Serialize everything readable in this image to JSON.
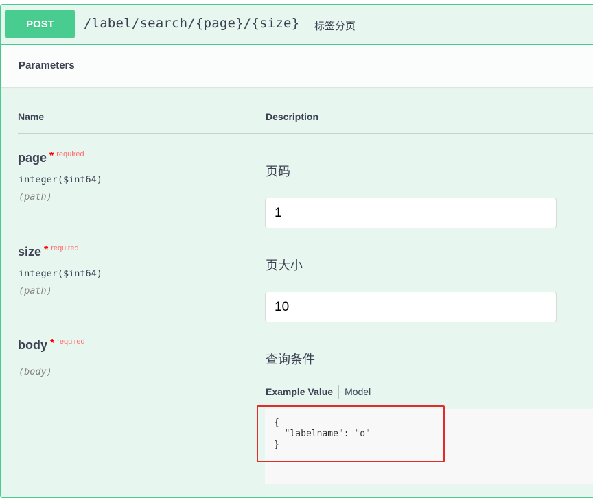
{
  "operation": {
    "method": "POST",
    "path": "/label/search/{page}/{size}",
    "summary": "标签分页",
    "method_color": "#49cc90"
  },
  "section": {
    "title": "Parameters"
  },
  "columns": {
    "name": "Name",
    "description": "Description"
  },
  "params": [
    {
      "name": "page",
      "required_star": "*",
      "required_label": "required",
      "type": "integer($int64)",
      "in": "(path)",
      "description": "页码",
      "value": "1"
    },
    {
      "name": "size",
      "required_star": "*",
      "required_label": "required",
      "type": "integer($int64)",
      "in": "(path)",
      "description": "页大小",
      "value": "10"
    },
    {
      "name": "body",
      "required_star": "*",
      "required_label": "required",
      "in": "(body)",
      "description": "查询条件",
      "tabs": {
        "example_value": "Example Value",
        "model": "Model"
      },
      "example": "{\n  \"labelname\": \"o\"\n}"
    }
  ],
  "annotation_color": "#e22b2b"
}
